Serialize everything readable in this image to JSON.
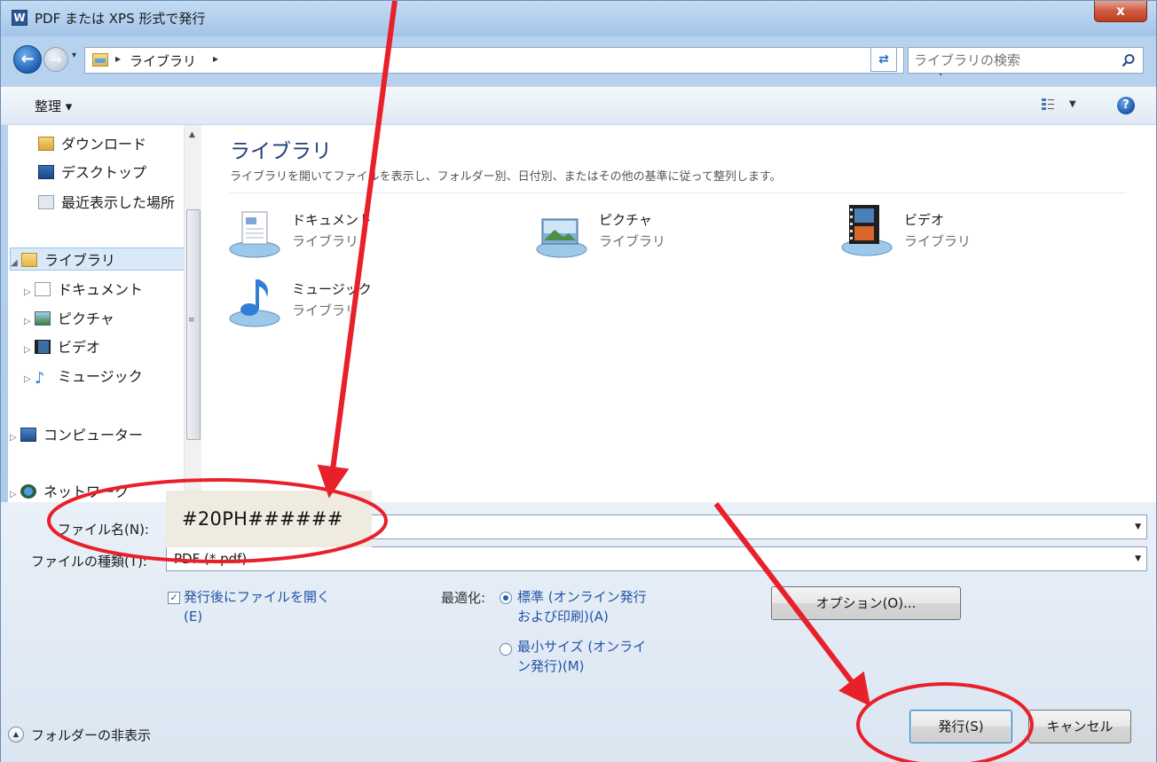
{
  "window": {
    "title": "PDF または XPS 形式で発行",
    "app_icon_letter": "W",
    "close_label": "x"
  },
  "address_bar": {
    "breadcrumb": [
      "ライブラリ"
    ],
    "search_placeholder": "ライブラリの検索"
  },
  "toolbar": {
    "organize_label": "整理 ▾"
  },
  "nav_pane": {
    "items": [
      {
        "label": "ダウンロード",
        "icon": "download-folder-icon"
      },
      {
        "label": "デスクトップ",
        "icon": "desktop-icon"
      },
      {
        "label": "最近表示した場所",
        "icon": "recent-places-icon"
      },
      {
        "label": "ライブラリ",
        "icon": "library-icon",
        "selected": true
      },
      {
        "label": "ドキュメント",
        "icon": "documents-icon"
      },
      {
        "label": "ピクチャ",
        "icon": "pictures-icon"
      },
      {
        "label": "ビデオ",
        "icon": "videos-icon"
      },
      {
        "label": "ミュージック",
        "icon": "music-icon"
      },
      {
        "label": "コンピューター",
        "icon": "computer-icon"
      },
      {
        "label": "ネットワーク",
        "icon": "network-icon"
      }
    ]
  },
  "content": {
    "heading": "ライブラリ",
    "description": "ライブラリを開いてファイルを表示し、フォルダー別、日付別、またはその他の基準に従って整列します。",
    "libraries": [
      {
        "name": "ドキュメント",
        "type": "ライブラリ",
        "icon": "documents-library-icon"
      },
      {
        "name": "ピクチャ",
        "type": "ライブラリ",
        "icon": "pictures-library-icon"
      },
      {
        "name": "ビデオ",
        "type": "ライブラリ",
        "icon": "videos-library-icon"
      },
      {
        "name": "ミュージック",
        "type": "ライブラリ",
        "icon": "music-library-icon"
      }
    ]
  },
  "form": {
    "filename_label": "ファイル名(N):",
    "filename_value": "",
    "filetype_label": "ファイルの種類(T):",
    "filetype_value": "PDF (*.pdf)",
    "open_after_publish": {
      "label_line1": "発行後にファイルを開く",
      "label_line2": "(E)",
      "checked": true
    },
    "optimize_label": "最適化:",
    "optimize_standard": {
      "line1": "標準 (オンライン発行",
      "line2": "および印刷)(A)",
      "selected": true
    },
    "optimize_minimum": {
      "line1": "最小サイズ (オンライ",
      "line2": "ン発行)(M)",
      "selected": false
    },
    "options_button": "オプション(O)...",
    "publish_button": "発行(S)",
    "cancel_button": "キャンセル",
    "hide_folders": "フォルダーの非表示"
  },
  "annotation": {
    "filename_hint": "#20PH######",
    "color": "#e8202a"
  }
}
